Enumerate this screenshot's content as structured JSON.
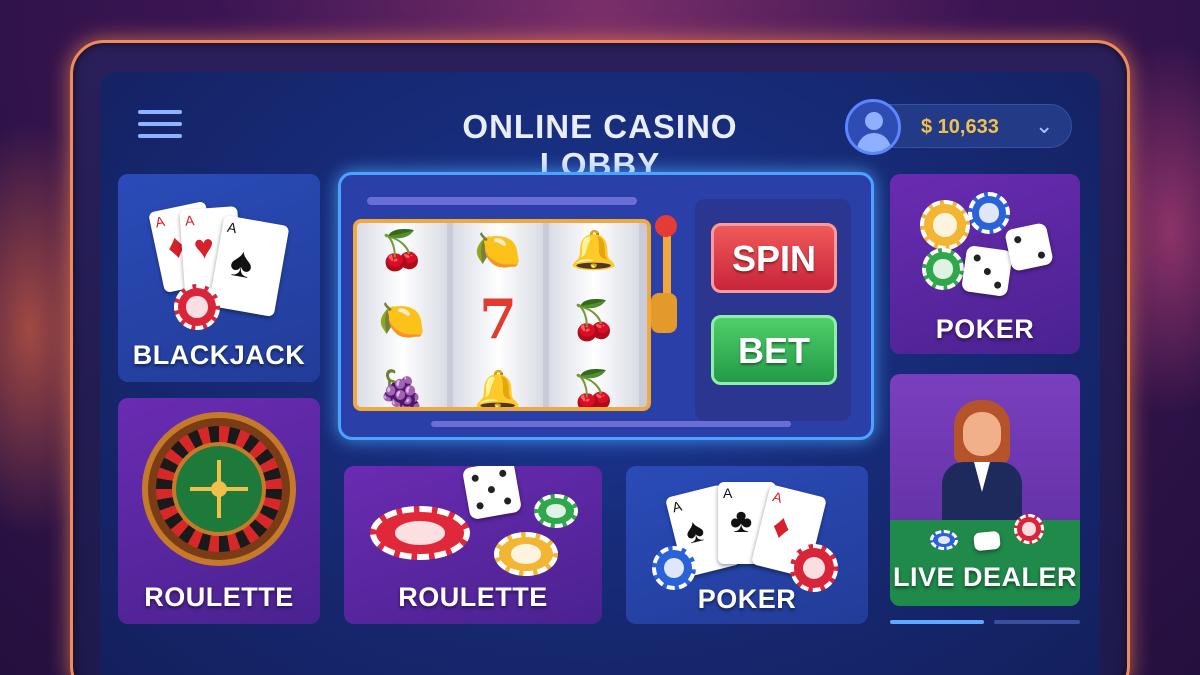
{
  "header": {
    "title": "ONLINE CASINO LOBBY",
    "balance": "$ 10,633"
  },
  "slot": {
    "spin_label": "SPIN",
    "bet_label": "BET",
    "reels": [
      [
        "🍒",
        "🍋",
        "🍇"
      ],
      [
        "🍋",
        "7",
        "🔔"
      ],
      [
        "🔔",
        "🍒",
        "🍒"
      ]
    ]
  },
  "tiles": [
    {
      "label": "BLACKJACK"
    },
    {
      "label": "ROULETTE"
    },
    {
      "label": "ROULETTE"
    },
    {
      "label": "POKER"
    },
    {
      "label": "POKER"
    },
    {
      "label": "LIVE DEALER"
    }
  ],
  "icons": {
    "menu": "menu-icon",
    "avatar": "user-avatar-icon",
    "chevron": "chevron-down-icon"
  },
  "colors": {
    "accent_blue": "#4aa3ff",
    "spin": "#c8243a",
    "bet": "#249a48",
    "balance": "#f2c04d"
  }
}
